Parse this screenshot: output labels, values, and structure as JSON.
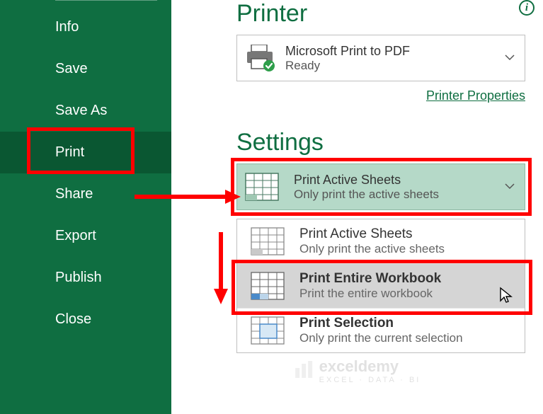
{
  "sidebar": {
    "items": [
      {
        "label": "Info"
      },
      {
        "label": "Save"
      },
      {
        "label": "Save As"
      },
      {
        "label": "Print"
      },
      {
        "label": "Share"
      },
      {
        "label": "Export"
      },
      {
        "label": "Publish"
      },
      {
        "label": "Close"
      }
    ]
  },
  "printer": {
    "heading": "Printer",
    "name": "Microsoft Print to PDF",
    "status": "Ready",
    "properties_link": "Printer Properties",
    "info_glyph": "i"
  },
  "settings": {
    "heading": "Settings",
    "selected": {
      "title": "Print Active Sheets",
      "subtitle": "Only print the active sheets"
    },
    "options": [
      {
        "title": "Print Active Sheets",
        "subtitle": "Only print the active sheets",
        "bold": false
      },
      {
        "title": "Print Entire Workbook",
        "subtitle": "Print the entire workbook",
        "bold": true,
        "highlight": true
      },
      {
        "title": "Print Selection",
        "subtitle": "Only print the current selection",
        "bold": true
      }
    ]
  },
  "watermark": {
    "brand": "exceldemy",
    "tag": "EXCEL · DATA · BI"
  },
  "colors": {
    "accent": "#0f6e41",
    "highlight_red": "#ff0000"
  }
}
